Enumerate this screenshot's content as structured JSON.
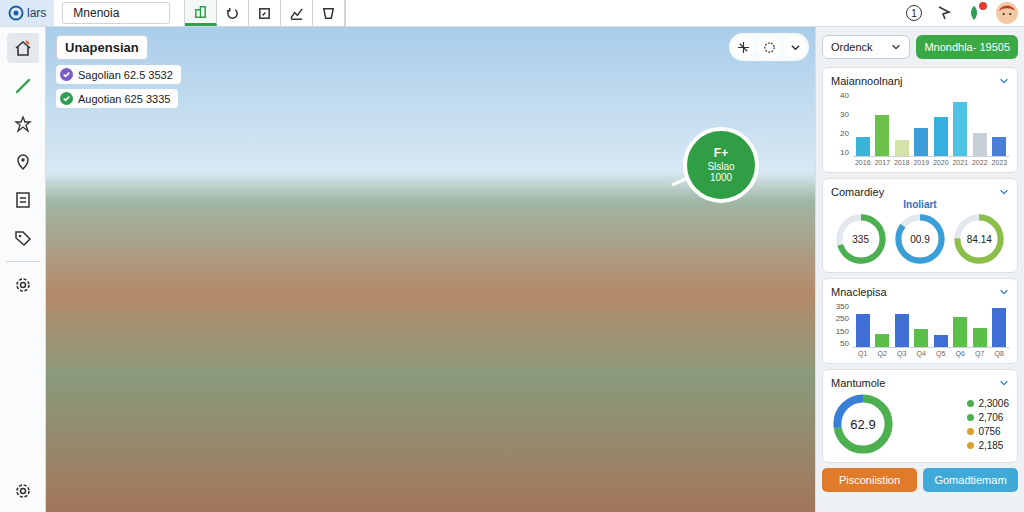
{
  "app": {
    "logo": "lars",
    "project": "Mnenoia"
  },
  "toolbar": [
    {
      "kind": "building",
      "selected": true
    },
    {
      "kind": "undo",
      "selected": false
    },
    {
      "kind": "box",
      "selected": false
    },
    {
      "kind": "chart",
      "selected": false
    },
    {
      "kind": "shield",
      "selected": false
    }
  ],
  "header_right": {
    "count": "1",
    "alert": true
  },
  "sidebar": {
    "top": [
      {
        "kind": "home",
        "selected": true
      },
      {
        "kind": "pencil",
        "selected": false
      },
      {
        "kind": "star",
        "selected": false
      },
      {
        "kind": "pin",
        "selected": false
      },
      {
        "kind": "doc",
        "selected": false
      },
      {
        "kind": "tag",
        "selected": false
      }
    ],
    "middle": [
      {
        "kind": "gear",
        "selected": false
      }
    ],
    "bottom": [
      {
        "kind": "gear",
        "selected": false
      }
    ]
  },
  "map": {
    "title": "Unapensian",
    "chips": [
      {
        "label": "Sagolian 62.5 3532",
        "color": "#7b5cc4"
      },
      {
        "label": "Augotian 625 3335",
        "color": "#2e9e4f"
      }
    ],
    "marker": {
      "icon": "F+",
      "label": "Slslao",
      "value": "1000"
    }
  },
  "panel": {
    "dropdown": "Ordenck",
    "action": "Mnondhla- 19505",
    "chart1": {
      "title": "Maiannoolnanj",
      "ticks": [
        "40",
        "30",
        "20",
        "10"
      ],
      "labels": [
        "2016",
        "2017",
        "2018",
        "2019",
        "2020",
        "2021",
        "2022",
        "2023"
      ],
      "values": [
        12,
        25,
        10,
        17,
        24,
        33,
        14,
        12
      ],
      "colors": [
        "#3bb4d8",
        "#6cc24a",
        "#d3e3a8",
        "#3a9fd8",
        "#35aee0",
        "#4fc3e3",
        "#c9cfd6",
        "#4a7fd6"
      ]
    },
    "gauges": {
      "title": "Comardiey",
      "subtitle": "Inoliart",
      "items": [
        {
          "value": "335",
          "level": 0.7,
          "color": "#4caf50"
        },
        {
          "value": "00.9",
          "level": 0.85,
          "color": "#3a9fd8"
        },
        {
          "value": "84.14",
          "level": 0.75,
          "color": "#8cbf4a"
        }
      ]
    },
    "chart2": {
      "title": "Mnaclepisa",
      "ticks": [
        "350",
        "250",
        "150",
        "50"
      ],
      "labels": [
        "Q1",
        "Q2",
        "Q3",
        "Q4",
        "Q5",
        "Q6",
        "Q7",
        "Q8"
      ],
      "values": [
        260,
        100,
        260,
        140,
        90,
        230,
        150,
        300
      ],
      "colors": [
        "#3f6fd6",
        "#5cbf4a",
        "#3f6fd6",
        "#5cbf4a",
        "#3f6fd6",
        "#5cbf4a",
        "#5cbf4a",
        "#3f6fd6"
      ]
    },
    "summary": {
      "title": "Mantumole",
      "value": "62.9",
      "segments": [
        {
          "level": 0.72,
          "color": "#4caf50"
        },
        {
          "level": 0.28,
          "color": "#3a7fd6"
        }
      ],
      "legend": [
        {
          "label": "2,3006",
          "color": "#4caf50"
        },
        {
          "label": "2,706",
          "color": "#4caf50"
        },
        {
          "label": "0756",
          "color": "#d9a030"
        },
        {
          "label": "2,185",
          "color": "#d9a030"
        }
      ]
    },
    "buttons": [
      {
        "label": "Pisconiistion",
        "color": "#e07b2a"
      },
      {
        "label": "Gomadtiemam",
        "color": "#3fa9d8"
      }
    ]
  }
}
